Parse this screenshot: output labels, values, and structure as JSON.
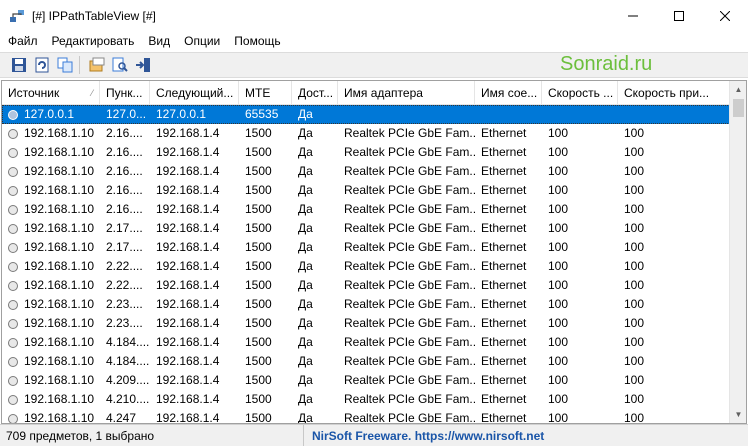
{
  "window": {
    "title": "[#] IPPathTableView [#]",
    "icon": "network-cable-icon"
  },
  "menu": [
    "Файл",
    "Редактировать",
    "Вид",
    "Опции",
    "Помощь"
  ],
  "toolbar": {
    "buttons": [
      "save-icon",
      "refresh-icon",
      "copy-icon",
      "properties-icon",
      "find-icon",
      "exit-icon"
    ]
  },
  "watermark": "Sonraid.ru",
  "table": {
    "columns": [
      "Источник",
      "Пунк...",
      "Следующий...",
      "MTE",
      "Дост...",
      "Имя адаптера",
      "Имя сое...",
      "Скорость ...",
      "Скорость при..."
    ],
    "rows": [
      [
        "127.0.0.1",
        "127.0...",
        "127.0.0.1",
        "65535",
        "Да",
        "",
        "",
        "",
        ""
      ],
      [
        "192.168.1.10",
        "2.16....",
        "192.168.1.4",
        "1500",
        "Да",
        "Realtek PCIe GbE Fam...",
        "Ethernet",
        "100",
        "100"
      ],
      [
        "192.168.1.10",
        "2.16....",
        "192.168.1.4",
        "1500",
        "Да",
        "Realtek PCIe GbE Fam...",
        "Ethernet",
        "100",
        "100"
      ],
      [
        "192.168.1.10",
        "2.16....",
        "192.168.1.4",
        "1500",
        "Да",
        "Realtek PCIe GbE Fam...",
        "Ethernet",
        "100",
        "100"
      ],
      [
        "192.168.1.10",
        "2.16....",
        "192.168.1.4",
        "1500",
        "Да",
        "Realtek PCIe GbE Fam...",
        "Ethernet",
        "100",
        "100"
      ],
      [
        "192.168.1.10",
        "2.16....",
        "192.168.1.4",
        "1500",
        "Да",
        "Realtek PCIe GbE Fam...",
        "Ethernet",
        "100",
        "100"
      ],
      [
        "192.168.1.10",
        "2.17....",
        "192.168.1.4",
        "1500",
        "Да",
        "Realtek PCIe GbE Fam...",
        "Ethernet",
        "100",
        "100"
      ],
      [
        "192.168.1.10",
        "2.17....",
        "192.168.1.4",
        "1500",
        "Да",
        "Realtek PCIe GbE Fam...",
        "Ethernet",
        "100",
        "100"
      ],
      [
        "192.168.1.10",
        "2.22....",
        "192.168.1.4",
        "1500",
        "Да",
        "Realtek PCIe GbE Fam...",
        "Ethernet",
        "100",
        "100"
      ],
      [
        "192.168.1.10",
        "2.22....",
        "192.168.1.4",
        "1500",
        "Да",
        "Realtek PCIe GbE Fam...",
        "Ethernet",
        "100",
        "100"
      ],
      [
        "192.168.1.10",
        "2.23....",
        "192.168.1.4",
        "1500",
        "Да",
        "Realtek PCIe GbE Fam...",
        "Ethernet",
        "100",
        "100"
      ],
      [
        "192.168.1.10",
        "2.23....",
        "192.168.1.4",
        "1500",
        "Да",
        "Realtek PCIe GbE Fam...",
        "Ethernet",
        "100",
        "100"
      ],
      [
        "192.168.1.10",
        "4.184....",
        "192.168.1.4",
        "1500",
        "Да",
        "Realtek PCIe GbE Fam...",
        "Ethernet",
        "100",
        "100"
      ],
      [
        "192.168.1.10",
        "4.184....",
        "192.168.1.4",
        "1500",
        "Да",
        "Realtek PCIe GbE Fam...",
        "Ethernet",
        "100",
        "100"
      ],
      [
        "192.168.1.10",
        "4.209....",
        "192.168.1.4",
        "1500",
        "Да",
        "Realtek PCIe GbE Fam...",
        "Ethernet",
        "100",
        "100"
      ],
      [
        "192.168.1.10",
        "4.210....",
        "192.168.1.4",
        "1500",
        "Да",
        "Realtek PCIe GbE Fam...",
        "Ethernet",
        "100",
        "100"
      ],
      [
        "192.168.1.10",
        "4.247",
        "192.168.1.4",
        "1500",
        "Да",
        "Realtek PCIe GbE Fam...",
        "Ethernet",
        "100",
        "100"
      ]
    ],
    "selected_row": 0
  },
  "status": {
    "count": "709 предметов, 1 выбрано",
    "link": "NirSoft Freeware. https://www.nirsoft.net"
  },
  "colors": {
    "selection": "#0078d7",
    "link": "#1a55a8",
    "watermark": "#6cbf3c"
  }
}
